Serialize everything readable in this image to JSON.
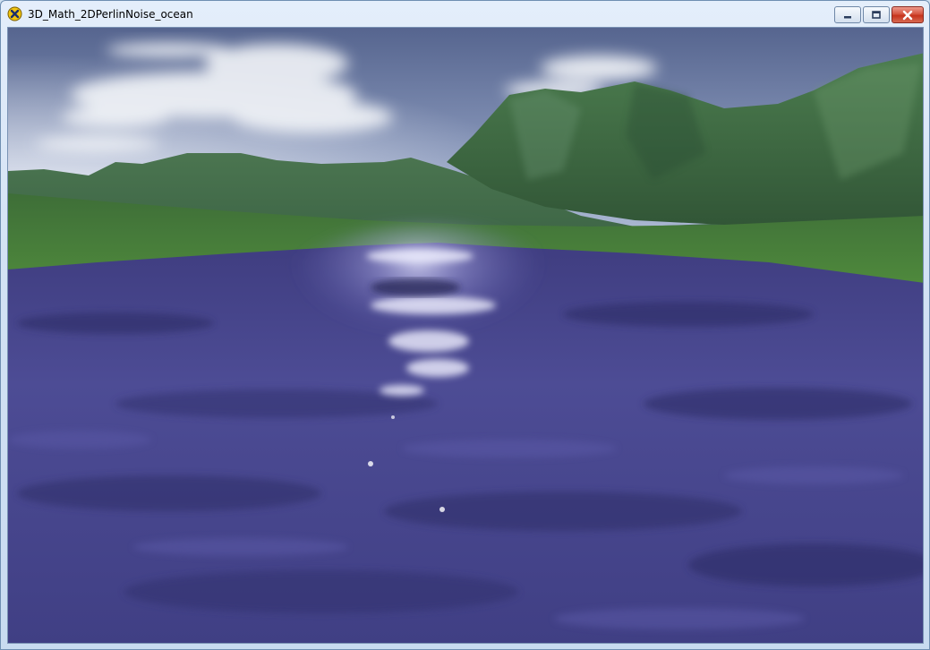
{
  "window": {
    "title": "3D_Math_2DPerlinNoise_ocean",
    "icon": "yellow-x-app-icon",
    "controls": [
      {
        "name": "minimize",
        "icon": "minimize-icon"
      },
      {
        "name": "maximize",
        "icon": "maximize-icon"
      },
      {
        "name": "close",
        "icon": "close-icon"
      }
    ]
  },
  "scene": {
    "description_tags": [
      "sky",
      "clouds",
      "green-mountains",
      "purple-ocean",
      "sun-glare"
    ],
    "colors": {
      "sky_top": "#5e6f99",
      "sky_horizon": "#c7d2e4",
      "mountain": "#3f6a4a",
      "grass": "#4c7a3a",
      "ocean": "#46458c",
      "ocean_dark": "#2f2d66",
      "glare": "#d8d8ff"
    }
  }
}
